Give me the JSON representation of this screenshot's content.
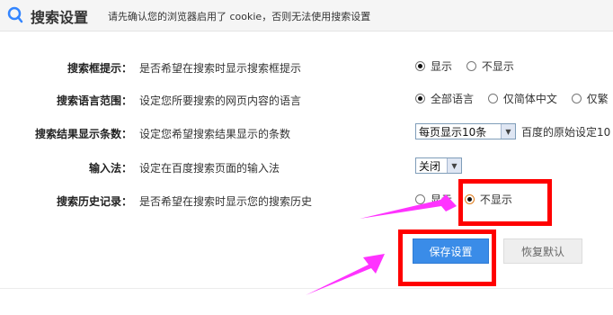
{
  "header": {
    "title": "搜索设置",
    "notice": "请先确认您的浏览器启用了 cookie，否则无法使用搜索设置"
  },
  "settings": [
    {
      "label": "搜索框提示：",
      "desc": "是否希望在搜索时显示搜索框提示",
      "options": [
        {
          "text": "显示",
          "checked": true
        },
        {
          "text": "不显示",
          "checked": false
        }
      ]
    },
    {
      "label": "搜索语言范围：",
      "desc": "设定您所要搜索的网页内容的语言",
      "options": [
        {
          "text": "全部语言",
          "checked": true
        },
        {
          "text": "仅简体中文",
          "checked": false
        },
        {
          "text": "仅繁",
          "checked": false
        }
      ]
    },
    {
      "label": "搜索结果显示条数：",
      "desc": "设定您希望搜索结果显示的条数",
      "select": "每页显示10条",
      "after": "百度的原始设定10"
    },
    {
      "label": "输入法：",
      "desc": "设定在百度搜索页面的输入法",
      "select": "关闭"
    },
    {
      "label": "搜索历史记录：",
      "desc": "是否希望在搜索时显示您的搜索历史",
      "options": [
        {
          "text": "显示",
          "checked": false
        },
        {
          "text": "不显示",
          "checked": true
        }
      ]
    }
  ],
  "buttons": {
    "save": "保存设置",
    "reset": "恢复默认"
  },
  "colors": {
    "accent": "#3a8ce8",
    "highlight": "#ff0000",
    "arrow": "#ff33ff"
  },
  "icons": {
    "header": "magnifier-icon"
  }
}
